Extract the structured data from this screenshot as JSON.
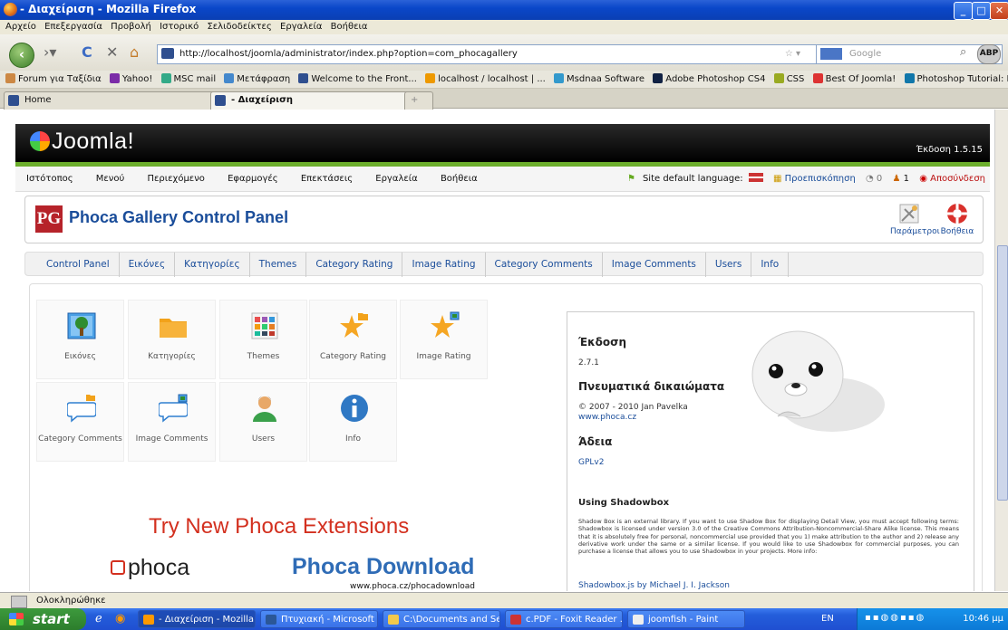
{
  "window": {
    "title": "- Διαχείριση - Mozilla Firefox"
  },
  "menubar": {
    "items": [
      "Αρχείο",
      "Επεξεργασία",
      "Προβολή",
      "Ιστορικό",
      "Σελιδοδείκτες",
      "Εργαλεία",
      "Βοήθεια"
    ]
  },
  "navbar": {
    "url": "http://localhost/joomla/administrator/index.php?option=com_phocagallery",
    "search_placeholder": "Google",
    "abp_label": "ABP"
  },
  "bookmarks": [
    "Forum για Ταξίδια",
    "Yahoo!",
    "MSC mail",
    "Μετάφραση",
    "Welcome to the Front...",
    "localhost / localhost | ...",
    "Msdnaa Software",
    "Adobe Photoshop CS4",
    "CSS",
    "Best Of Joomla!",
    "Photoshop Tutorial: H..."
  ],
  "tabs": [
    {
      "label": "Home"
    },
    {
      "label": "- Διαχείριση"
    }
  ],
  "joomla": {
    "logo": "Joomla!",
    "version": "Έκδοση 1.5.15",
    "menu": [
      "Ιστότοπος",
      "Μενού",
      "Περιεχόμενο",
      "Εφαρμογές",
      "Επεκτάσεις",
      "Εργαλεία",
      "Βοήθεια"
    ],
    "site_language": "Site default language:",
    "preview": "Προεπισκόπηση",
    "count_a": "0",
    "count_b": "1",
    "logout": "Αποσύνδεση"
  },
  "cpanel": {
    "logo": "PG",
    "title": "Phoca Gallery Control Panel",
    "params_label": "Παράμετροι",
    "help_label": "Βοήθεια"
  },
  "submenu": [
    "Control Panel",
    "Εικόνες",
    "Κατηγορίες",
    "Themes",
    "Category Rating",
    "Image Rating",
    "Category Comments",
    "Image Comments",
    "Users",
    "Info"
  ],
  "icons": [
    {
      "label": "Εικόνες",
      "icon": "image-icon"
    },
    {
      "label": "Κατηγορίες",
      "icon": "folder-icon"
    },
    {
      "label": "Themes",
      "icon": "themes-icon"
    },
    {
      "label": "Category Rating",
      "icon": "star-folder-icon"
    },
    {
      "label": "Image Rating",
      "icon": "star-image-icon"
    },
    {
      "label": "Category Comments",
      "icon": "comment-folder-icon"
    },
    {
      "label": "Image Comments",
      "icon": "comment-image-icon"
    },
    {
      "label": "Users",
      "icon": "user-icon"
    },
    {
      "label": "Info",
      "icon": "info-icon"
    }
  ],
  "info": {
    "version_heading": "Έκδοση",
    "version_value": "2.7.1",
    "copyright_heading": "Πνευματικά δικαιώματα",
    "copyright_value": "© 2007 - 2010 Jan Pavelka",
    "copyright_link": "www.phoca.cz",
    "license_heading": "Άδεια",
    "license_value": "GPLv2",
    "shadowbox_heading": "Using Shadowbox",
    "shadowbox_text": "Shadow Box is an external library. If you want to use Shadow Box for displaying Detail View, you must accept following terms: Shadowbox is licensed under version 3.0 of the Creative Commons Attribution-Noncommercial-Share Alike license. This means that it is absolutely free for personal, noncommercial use provided that you 1) make attribution to the author and 2) release any derivative work under the same or a similar license. If you would like to use Shadowbox for commercial purposes, you can purchase a license that allows you to use Shadowbox in your projects. More info:",
    "shadowbox_credit": "Shadowbox.js by Michael J. I. Jackson"
  },
  "promo": {
    "headline": "Try New Phoca Extensions",
    "logo_text": "phoca",
    "download": "Phoca Download",
    "url": "www.phoca.cz/phocadownload"
  },
  "statusbar": {
    "text": "Ολοκληρώθηκε"
  },
  "taskbar": {
    "start": "start",
    "tasks": [
      "- Διαχείριση - Mozilla ...",
      "Πτυχιακή - Microsoft ...",
      "C:\\Documents and Se...",
      "c.PDF - Foxit Reader ...",
      "joomfish - Paint"
    ],
    "lang": "EN",
    "clock": "10:46 μμ"
  },
  "colors": {
    "joomla_green": "#6cae2c",
    "link_blue": "#1a4d9a",
    "promo_red": "#d3301f"
  }
}
